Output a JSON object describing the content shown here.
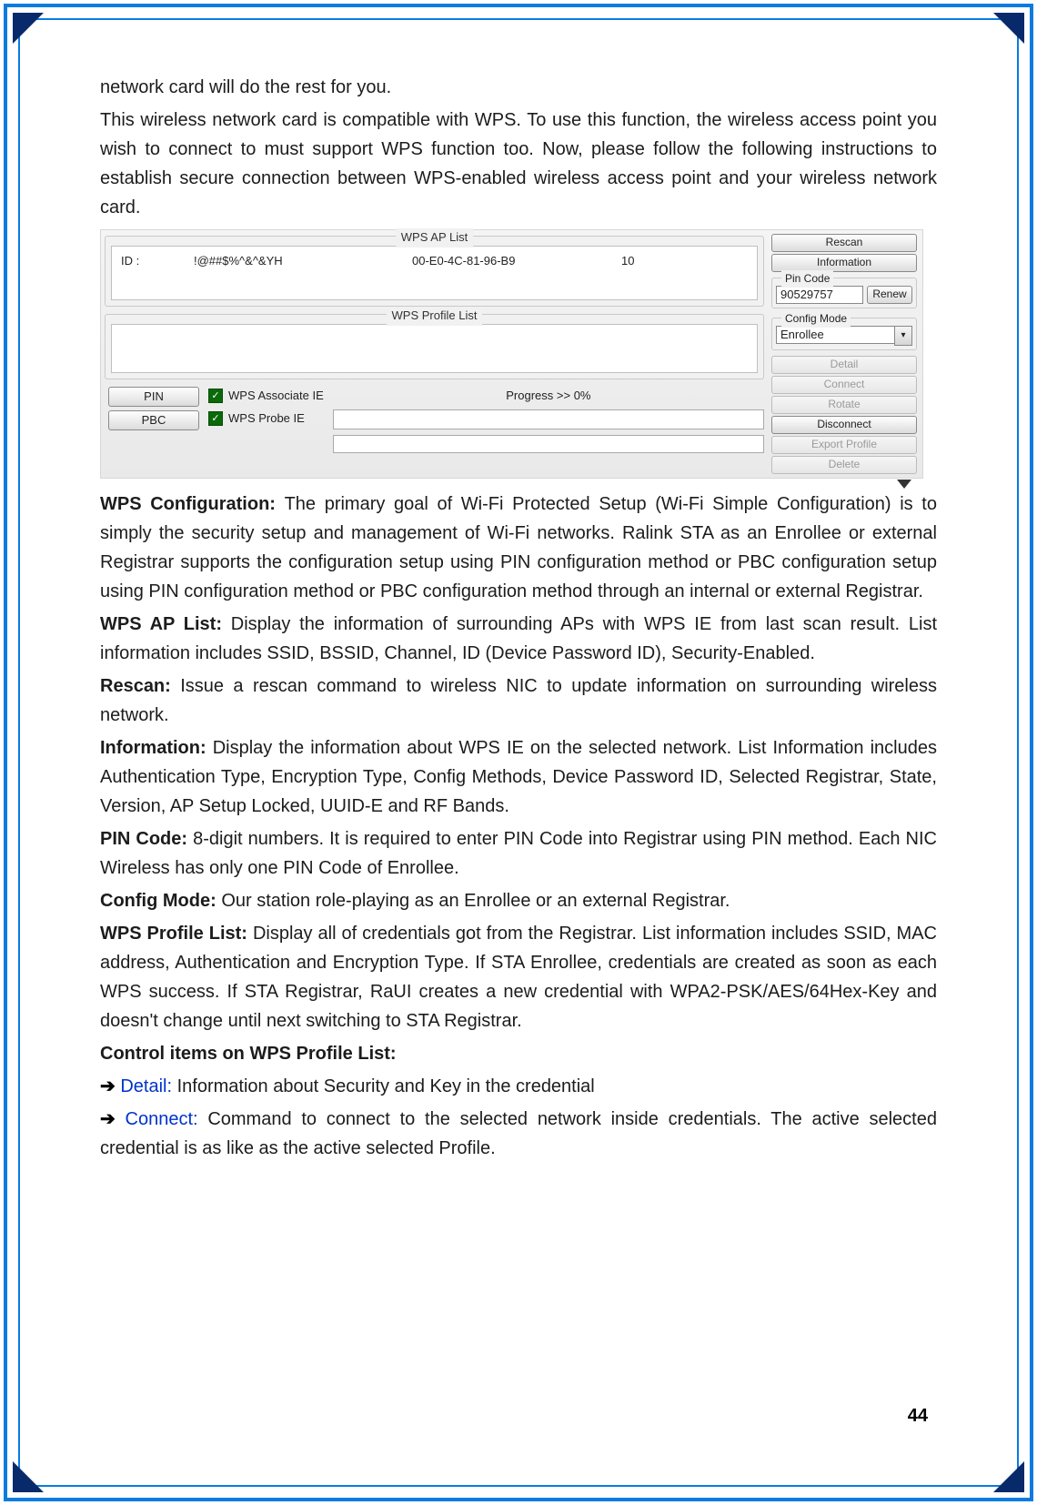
{
  "intro_line1": "network card will do the rest for you.",
  "intro_para": "This wireless network card is compatible with WPS. To use this function, the wireless access point you wish to connect to must support WPS function too. Now, please follow the following instructions to establish secure connection between WPS-enabled wireless access point and your wireless network card.",
  "screenshot": {
    "ap_list_title": "WPS AP List",
    "profile_list_title": "WPS Profile List",
    "ap_row": {
      "id": "ID :",
      "ssid": "!@##$%^&^&YH",
      "bssid": "00-E0-4C-81-96-B9",
      "channel": "10"
    },
    "pin_btn": "PIN",
    "pbc_btn": "PBC",
    "assoc_ie": "WPS Associate IE",
    "probe_ie": "WPS Probe IE",
    "progress": "Progress >> 0%",
    "side": {
      "rescan": "Rescan",
      "information": "Information",
      "pin_code_label": "Pin Code",
      "pin_code_value": "90529757",
      "renew": "Renew",
      "config_mode_label": "Config Mode",
      "config_mode_value": "Enrollee",
      "detail": "Detail",
      "connect": "Connect",
      "rotate": "Rotate",
      "disconnect": "Disconnect",
      "export": "Export Profile",
      "delete": "Delete"
    }
  },
  "wps_configuration_label": "WPS Configuration: ",
  "wps_configuration_text": "The primary goal of Wi-Fi Protected Setup (Wi-Fi Simple Configuration) is to simply the security setup and management of Wi-Fi networks. Ralink STA as an Enrollee or external Registrar supports the configuration setup using PIN configuration method or PBC configuration setup using PIN configuration method or PBC configuration method through an internal or external Registrar.",
  "wps_ap_list_label": "WPS AP List: ",
  "wps_ap_list_text": "Display the information of surrounding APs with WPS IE from last scan result. List information includes SSID, BSSID, Channel, ID (Device Password ID), Security-Enabled.",
  "rescan_label": "Rescan: ",
  "rescan_text": "Issue a rescan command to wireless NIC to update information on surrounding wireless network.",
  "information_label": "Information: ",
  "information_text": "Display the information about WPS IE on the selected network. List Information includes Authentication Type, Encryption Type, Config Methods, Device Password ID, Selected Registrar, State, Version, AP Setup Locked, UUID-E and RF Bands.",
  "pin_code_label": "PIN Code: ",
  "pin_code_text": "8-digit numbers. It is required to enter PIN Code into Registrar using PIN method. Each NIC Wireless has only one PIN Code of Enrollee.",
  "config_mode_label": "Config Mode: ",
  "config_mode_text": "Our station role-playing as an Enrollee or an external Registrar.",
  "wps_profile_list_label": "WPS Profile List: ",
  "wps_profile_list_text": "Display all of credentials got from the Registrar. List information includes SSID, MAC address, Authentication and Encryption Type. If STA Enrollee, credentials are created as soon as each WPS success. If STA Registrar, RaUI creates a new credential with WPA2-PSK/AES/64Hex-Key and doesn't change until next switching to STA Registrar.",
  "control_items_heading": "Control items on WPS Profile List:",
  "detail_term": "Detail:",
  "detail_text": " Information about Security and Key in the credential",
  "connect_term": "Connect:",
  "connect_text": " Command to connect to the selected network inside credentials. The active selected credential is as like as the active selected Profile.",
  "page_number": "44"
}
